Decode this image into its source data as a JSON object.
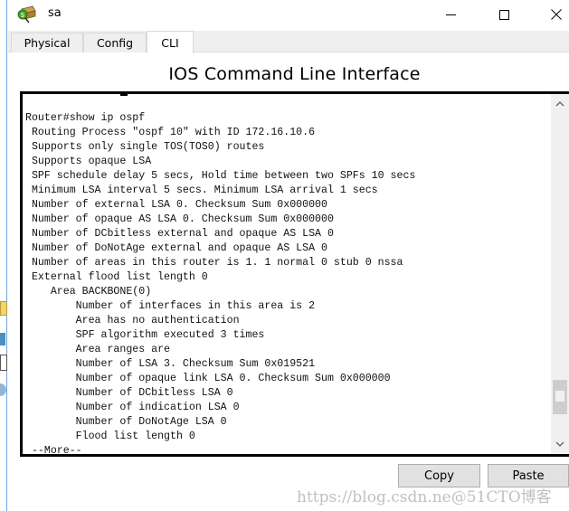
{
  "window": {
    "title": "sa",
    "icon": "router-app-icon",
    "controls": {
      "minimize": "minimize-icon",
      "maximize": "maximize-icon",
      "close": "close-icon"
    }
  },
  "tabs": [
    {
      "label": "Physical",
      "active": false
    },
    {
      "label": "Config",
      "active": false
    },
    {
      "label": "CLI",
      "active": true
    }
  ],
  "heading": "IOS Command Line Interface",
  "terminal": {
    "lines": [
      "Router#show ip ospf",
      " Routing Process \"ospf 10\" with ID 172.16.10.6",
      " Supports only single TOS(TOS0) routes",
      " Supports opaque LSA",
      " SPF schedule delay 5 secs, Hold time between two SPFs 10 secs",
      " Minimum LSA interval 5 secs. Minimum LSA arrival 1 secs",
      " Number of external LSA 0. Checksum Sum 0x000000",
      " Number of opaque AS LSA 0. Checksum Sum 0x000000",
      " Number of DCbitless external and opaque AS LSA 0",
      " Number of DoNotAge external and opaque AS LSA 0",
      " Number of areas in this router is 1. 1 normal 0 stub 0 nssa",
      " External flood list length 0",
      "    Area BACKBONE(0)",
      "        Number of interfaces in this area is 2",
      "        Area has no authentication",
      "        SPF algorithm executed 3 times",
      "        Area ranges are",
      "        Number of LSA 3. Checksum Sum 0x019521",
      "        Number of opaque link LSA 0. Checksum Sum 0x000000",
      "        Number of DCbitless LSA 0",
      "        Number of indication LSA 0",
      "        Number of DoNotAge LSA 0",
      "        Flood list length 0",
      " --More--"
    ],
    "scroll_position_fraction": 0.93
  },
  "buttons": {
    "copy": "Copy",
    "paste": "Paste"
  },
  "watermark": "https://blog.csdn.ne@51CTO博客"
}
